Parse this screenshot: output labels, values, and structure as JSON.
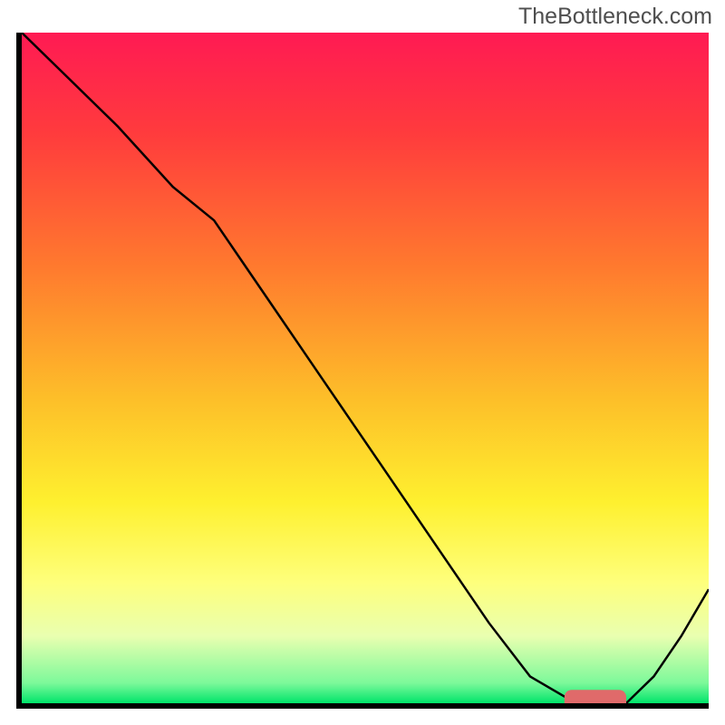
{
  "watermark": "TheBottleneck.com",
  "chart_data": {
    "type": "line",
    "title": "",
    "xlabel": "",
    "ylabel": "",
    "xlim": [
      0,
      100
    ],
    "ylim": [
      0,
      100
    ],
    "background_gradient": {
      "orientation": "vertical",
      "stops": [
        {
          "pos": 0.0,
          "color": "#ff1a53"
        },
        {
          "pos": 0.15,
          "color": "#ff3b3d"
        },
        {
          "pos": 0.35,
          "color": "#ff7a2e"
        },
        {
          "pos": 0.55,
          "color": "#fdc029"
        },
        {
          "pos": 0.7,
          "color": "#fef02f"
        },
        {
          "pos": 0.82,
          "color": "#feff7c"
        },
        {
          "pos": 0.9,
          "color": "#e9ffb0"
        },
        {
          "pos": 0.97,
          "color": "#7cf99a"
        },
        {
          "pos": 1.0,
          "color": "#00e46a"
        }
      ]
    },
    "series": [
      {
        "name": "curve",
        "color": "#000000",
        "stroke_width": 2.5,
        "x": [
          0,
          6,
          14,
          22,
          28,
          36,
          44,
          52,
          60,
          68,
          74,
          79,
          84,
          88,
          92,
          96,
          100
        ],
        "y": [
          100,
          94,
          86,
          77,
          72,
          60,
          48,
          36,
          24,
          12,
          4,
          1,
          0,
          0,
          4,
          10,
          17
        ]
      }
    ],
    "markers": [
      {
        "name": "optimal-range",
        "type": "rounded-bar",
        "color": "#e06a6a",
        "x_start": 79,
        "x_end": 88,
        "y": 0.5,
        "height": 3
      }
    ]
  }
}
